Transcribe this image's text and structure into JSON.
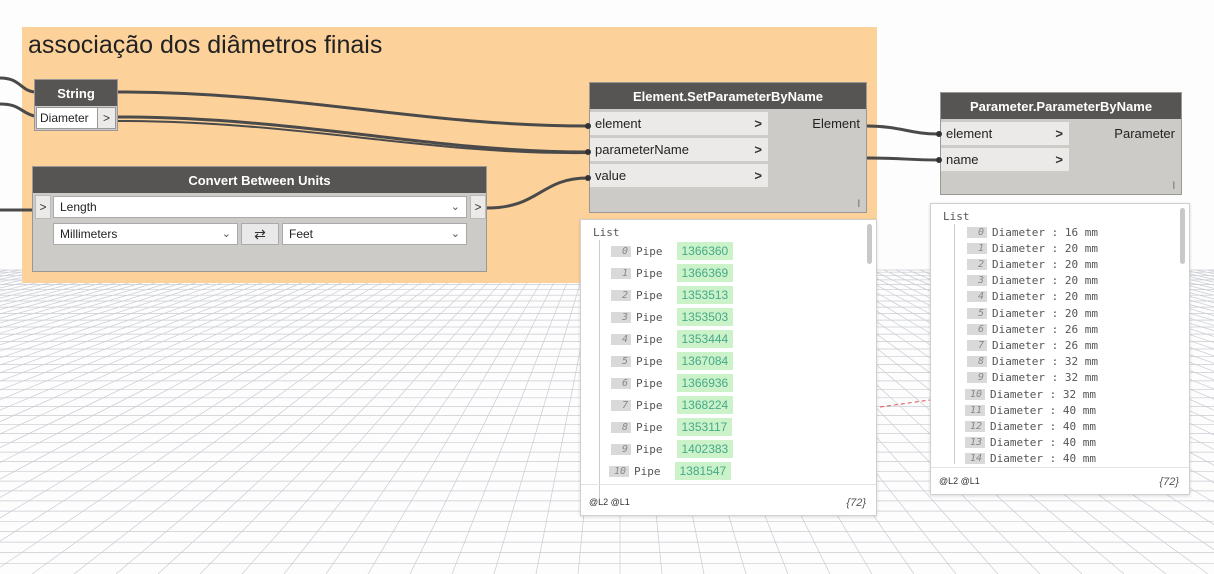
{
  "group": {
    "title": "associação dos diâmetros finais"
  },
  "string_node": {
    "title": "String",
    "value": "Diameter",
    "out_chevron": ">"
  },
  "convert_node": {
    "title": "Convert Between Units",
    "in_chevron": ">",
    "out_chevron": ">",
    "conversion": "Length",
    "from_unit": "Millimeters",
    "to_unit": "Feet",
    "swap_icon": "⇄",
    "chevron_icon": "⌄"
  },
  "setparam_node": {
    "title": "Element.SetParameterByName",
    "inputs": [
      {
        "label": "element",
        "arrow": ">"
      },
      {
        "label": "parameterName",
        "arrow": ">"
      },
      {
        "label": "value",
        "arrow": ">"
      }
    ],
    "output": "Element",
    "lacing": "l"
  },
  "parambyname_node": {
    "title": "Parameter.ParameterByName",
    "inputs": [
      {
        "label": "element",
        "arrow": ">"
      },
      {
        "label": "name",
        "arrow": ">"
      }
    ],
    "output": "Parameter",
    "lacing": "l"
  },
  "preview_elements": {
    "title": "List",
    "items": [
      {
        "index": "0",
        "type": "Pipe",
        "id": "1366360"
      },
      {
        "index": "1",
        "type": "Pipe",
        "id": "1366369"
      },
      {
        "index": "2",
        "type": "Pipe",
        "id": "1353513"
      },
      {
        "index": "3",
        "type": "Pipe",
        "id": "1353503"
      },
      {
        "index": "4",
        "type": "Pipe",
        "id": "1353444"
      },
      {
        "index": "5",
        "type": "Pipe",
        "id": "1367084"
      },
      {
        "index": "6",
        "type": "Pipe",
        "id": "1366936"
      },
      {
        "index": "7",
        "type": "Pipe",
        "id": "1368224"
      },
      {
        "index": "8",
        "type": "Pipe",
        "id": "1353117"
      },
      {
        "index": "9",
        "type": "Pipe",
        "id": "1402383"
      },
      {
        "index": "10",
        "type": "Pipe",
        "id": "1381547"
      }
    ],
    "levels": "@L2 @L1",
    "count": "{72}"
  },
  "preview_params": {
    "title": "List",
    "items": [
      {
        "index": "0",
        "text": "Diameter : 16 mm"
      },
      {
        "index": "1",
        "text": "Diameter : 20 mm"
      },
      {
        "index": "2",
        "text": "Diameter : 20 mm"
      },
      {
        "index": "3",
        "text": "Diameter : 20 mm"
      },
      {
        "index": "4",
        "text": "Diameter : 20 mm"
      },
      {
        "index": "5",
        "text": "Diameter : 20 mm"
      },
      {
        "index": "6",
        "text": "Diameter : 26 mm"
      },
      {
        "index": "7",
        "text": "Diameter : 26 mm"
      },
      {
        "index": "8",
        "text": "Diameter : 32 mm"
      },
      {
        "index": "9",
        "text": "Diameter : 32 mm"
      },
      {
        "index": "10",
        "text": "Diameter : 32 mm"
      },
      {
        "index": "11",
        "text": "Diameter : 40 mm"
      },
      {
        "index": "12",
        "text": "Diameter : 40 mm"
      },
      {
        "index": "13",
        "text": "Diameter : 40 mm"
      },
      {
        "index": "14",
        "text": "Diameter : 40 mm"
      }
    ],
    "levels": "@L2 @L1",
    "count": "{72}"
  },
  "colors": {
    "group_bg": "#fdd19a",
    "node_header": "#575553",
    "node_body": "#cdcbc8",
    "wire": "#4a4a4a",
    "value_highlight": "#cbf2c9"
  }
}
